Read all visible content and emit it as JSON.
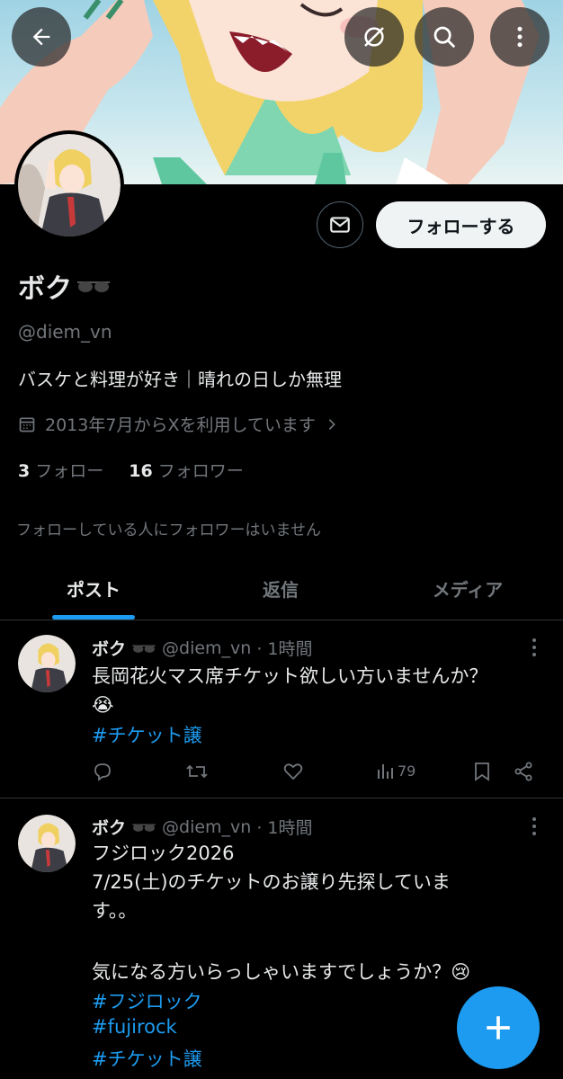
{
  "header": {
    "back_icon": "arrow-left-icon",
    "sync_icon": "sync-icon",
    "search_icon": "search-icon",
    "more_icon": "more-vertical-icon"
  },
  "profile": {
    "name": "ボク",
    "name_emoji": "🕶",
    "handle": "@diem_vn",
    "bio": "バスケと料理が好き｜晴れの日しか無理",
    "joined": "2013年7月からXを利用しています",
    "following_count": "3",
    "following_label": "フォロー",
    "followers_count": "16",
    "followers_label": "フォロワー",
    "mutual_note": "フォローしている人にフォロワーはいません",
    "follow_button": "フォローする",
    "message_icon": "mail-icon"
  },
  "tabs": [
    {
      "label": "ポスト",
      "active": true
    },
    {
      "label": "返信",
      "active": false
    },
    {
      "label": "メディア",
      "active": false
    }
  ],
  "posts": [
    {
      "name": "ボク",
      "handle": "@diem_vn",
      "time": "· 1時間",
      "text": "長岡花火マス席チケット欲しい方いませんか？",
      "emoji": "😭",
      "hashtags": [
        "#チケット譲"
      ],
      "views": "79"
    },
    {
      "name": "ボク",
      "handle": "@diem_vn",
      "time": "· 1時間",
      "line1": "フジロック2026",
      "line2": "7/25(土)のチケットのお譲り先探していま",
      "line3": "す。。",
      "line4": "気になる方いらっしゃいますでしょうか？",
      "emoji": "😢",
      "hashtags": [
        "#フジロック",
        "#fujirock",
        "#チケット譲"
      ]
    }
  ],
  "colors": {
    "accent": "#1d9bf0",
    "background": "#000000",
    "text_primary": "#e7e9ea",
    "text_secondary": "#71767b"
  },
  "fab": {
    "icon": "plus-icon"
  }
}
